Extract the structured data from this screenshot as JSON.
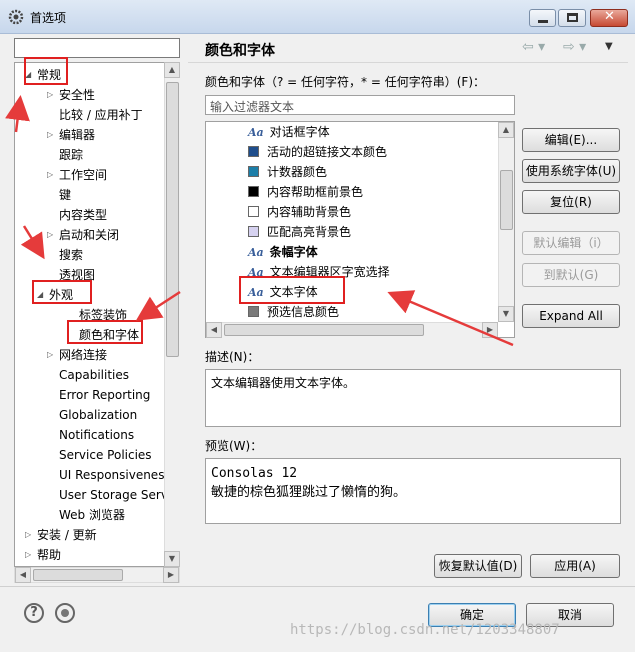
{
  "window": {
    "title": "首选项"
  },
  "tree": {
    "items": [
      {
        "label": "常规",
        "arrow": "◢",
        "selected_box": true
      },
      {
        "label": "安全性",
        "arrow": "▷"
      },
      {
        "label": "比较 / 应用补丁",
        "arrow": ""
      },
      {
        "label": "编辑器",
        "arrow": "▷"
      },
      {
        "label": "跟踪",
        "arrow": ""
      },
      {
        "label": "工作空间",
        "arrow": "▷"
      },
      {
        "label": "键",
        "arrow": ""
      },
      {
        "label": "内容类型",
        "arrow": ""
      },
      {
        "label": "启动和关闭",
        "arrow": "▷"
      },
      {
        "label": "搜索",
        "arrow": ""
      },
      {
        "label": "透视图",
        "arrow": ""
      },
      {
        "label": "外观",
        "arrow": "◢"
      },
      {
        "label": "标签装饰",
        "arrow": ""
      },
      {
        "label": "颜色和字体",
        "arrow": ""
      },
      {
        "label": "网络连接",
        "arrow": "▷"
      },
      {
        "label": "Capabilities",
        "arrow": ""
      },
      {
        "label": "Error Reporting",
        "arrow": ""
      },
      {
        "label": "Globalization",
        "arrow": ""
      },
      {
        "label": "Notifications",
        "arrow": ""
      },
      {
        "label": "Service Policies",
        "arrow": ""
      },
      {
        "label": "UI Responsiveness",
        "arrow": ""
      },
      {
        "label": "User Storage Serv",
        "arrow": ""
      },
      {
        "label": "Web 浏览器",
        "arrow": ""
      },
      {
        "label": "安装 / 更新",
        "arrow": "▷"
      },
      {
        "label": "帮助",
        "arrow": "▷"
      }
    ]
  },
  "page": {
    "title": "颜色和字体",
    "filter_label": "颜色和字体（? = 任何字符，* = 任何字符串）(F)：",
    "filter_placeholder": "输入过滤器文本",
    "list": [
      {
        "icon": "font",
        "label": "对话框字体"
      },
      {
        "icon": "swatch",
        "color": "#1f4e8c",
        "label": "活动的超链接文本颜色"
      },
      {
        "icon": "swatch",
        "color": "#1c7ea8",
        "label": "计数器颜色"
      },
      {
        "icon": "swatch",
        "color": "#000000",
        "label": "内容帮助框前景色"
      },
      {
        "icon": "swatch",
        "color": "#ffffff",
        "label": "内容辅助背景色"
      },
      {
        "icon": "swatch",
        "color": "#d6d2f0",
        "label": "匹配高亮背景色"
      },
      {
        "icon": "font",
        "label": "条幅字体",
        "bold": true
      },
      {
        "icon": "font",
        "label": "文本编辑器区字宽选择"
      },
      {
        "icon": "font",
        "label": "文本字体"
      },
      {
        "icon": "swatch",
        "color": "#7a7a7a",
        "label": "预选信息颜色"
      }
    ],
    "buttons": {
      "edit": "编辑(E)...",
      "use_system_font": "使用系统字体(U)",
      "reset": "复位(R)",
      "edit_default": "默认编辑（i）",
      "go_to_default": "到默认(G)",
      "expand_all": "Expand All"
    },
    "description_label": "描述(N)：",
    "description": "文本编辑器使用文本字体。",
    "preview_label": "预览(W)：",
    "preview_line1": "Consolas 12",
    "preview_line2": "敏捷的棕色狐狸跳过了懒惰的狗。",
    "restore_defaults": "恢复默认值(D)",
    "apply": "应用(A)"
  },
  "footer": {
    "ok": "确定",
    "cancel": "取消",
    "help_glyph": "?"
  },
  "watermark": "https://blog.csdn.net/1203348807"
}
